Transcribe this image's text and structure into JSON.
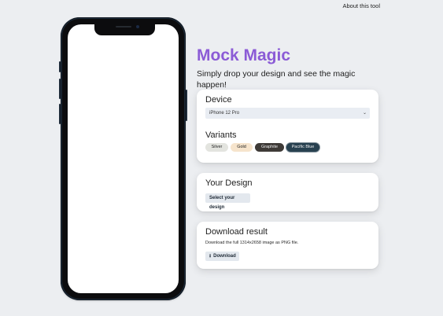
{
  "header": {
    "about_label": "About this tool"
  },
  "hero": {
    "title": "Mock Magic",
    "subtitle": "Simply drop your design and see the magic happen!"
  },
  "device_card": {
    "heading": "Device",
    "selected_device": "iPhone 12 Pro",
    "variants_heading": "Variants",
    "variants": [
      {
        "label": "Silver",
        "color": "#e3e4df"
      },
      {
        "label": "Gold",
        "color": "#f6e4cc"
      },
      {
        "label": "Graphite",
        "color": "#3e3a37"
      },
      {
        "label": "Pacific Blue",
        "color": "#284150",
        "selected": true
      }
    ]
  },
  "design_card": {
    "heading": "Your Design",
    "button_label": "Select your design"
  },
  "download_card": {
    "heading": "Download result",
    "description": "Download the full 1314x2658 image as PNG file.",
    "button_label": "Download",
    "button_icon": "download-icon"
  },
  "colors": {
    "accent": "#8b5bd6",
    "background": "#eceef1"
  }
}
